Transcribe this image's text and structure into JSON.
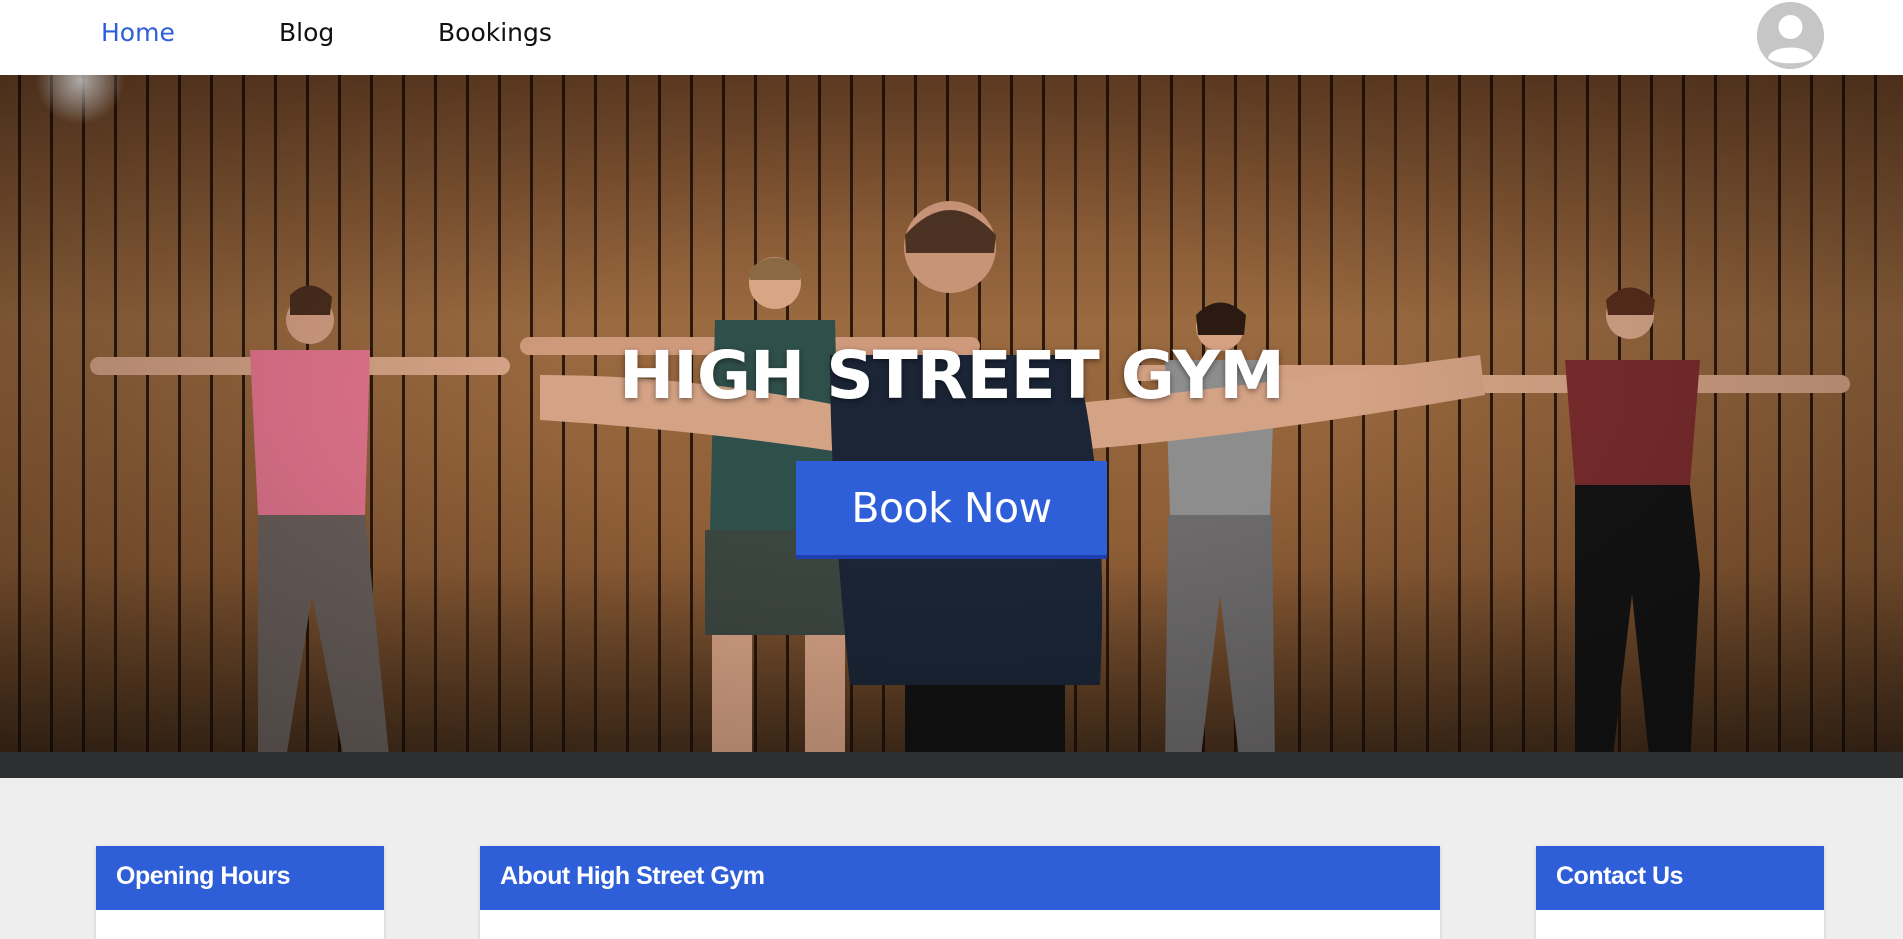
{
  "nav": {
    "items": [
      {
        "label": "Home",
        "active": true
      },
      {
        "label": "Blog",
        "active": false
      },
      {
        "label": "Bookings",
        "active": false
      }
    ],
    "avatar_icon": "user-avatar-icon"
  },
  "hero": {
    "title": "HIGH STREET GYM",
    "button_label": "Book Now"
  },
  "cards": {
    "opening_hours": {
      "title": "Opening Hours"
    },
    "about": {
      "title": "About High Street Gym"
    },
    "contact": {
      "title": "Contact Us"
    }
  },
  "colors": {
    "accent": "#2f5fd8",
    "page_bg": "#eeeeee",
    "nav_bg": "#ffffff",
    "active_link": "#2f5fd8"
  }
}
